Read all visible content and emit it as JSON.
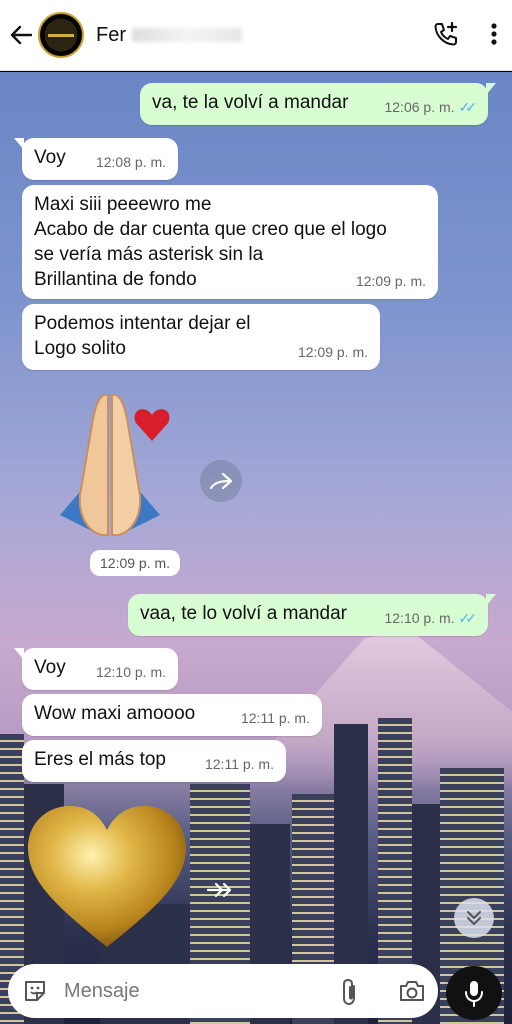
{
  "header": {
    "contact_name": "Fer",
    "back_icon": "arrow-left-icon",
    "call_icon": "add-call-icon",
    "menu_icon": "more-vert-icon"
  },
  "messages": [
    {
      "dir": "out",
      "text": "va, te la volví a mandar",
      "time": "12:06 p. m."
    },
    {
      "dir": "in",
      "text": "Voy",
      "time": "12:08 p. m."
    },
    {
      "dir": "in",
      "lines": [
        "Maxi siii peeewro me",
        "Acabo de dar cuenta que creo que el logo",
        "se vería más asterisk sin la",
        "Brillantina de fondo"
      ],
      "time": "12:09 p. m."
    },
    {
      "dir": "in",
      "lines": [
        "Podemos intentar dejar el",
        "Logo solito"
      ],
      "time": "12:09 p. m."
    },
    {
      "dir": "in",
      "type": "sticker",
      "sticker": "praying-hands-heart",
      "time": "12:09 p. m."
    },
    {
      "dir": "out",
      "text": "vaa, te lo volví a mandar",
      "time": "12:10 p. m."
    },
    {
      "dir": "in",
      "text": "Voy",
      "time": "12:10 p. m."
    },
    {
      "dir": "in",
      "text": "Wow maxi amoooo",
      "time": "12:11 p. m."
    },
    {
      "dir": "in",
      "text": "Eres el más top",
      "time": "12:11 p. m."
    },
    {
      "dir": "in",
      "type": "sticker",
      "sticker": "golden-heart"
    }
  ],
  "composer": {
    "placeholder": "Mensaje",
    "emoji_icon": "sticker-icon",
    "attach_icon": "paperclip-icon",
    "camera_icon": "camera-icon",
    "mic_icon": "microphone-icon"
  },
  "colors": {
    "outgoing_bubble": "#d9fdd3",
    "incoming_bubble": "#ffffff",
    "read_ticks": "#4fb6ec"
  }
}
